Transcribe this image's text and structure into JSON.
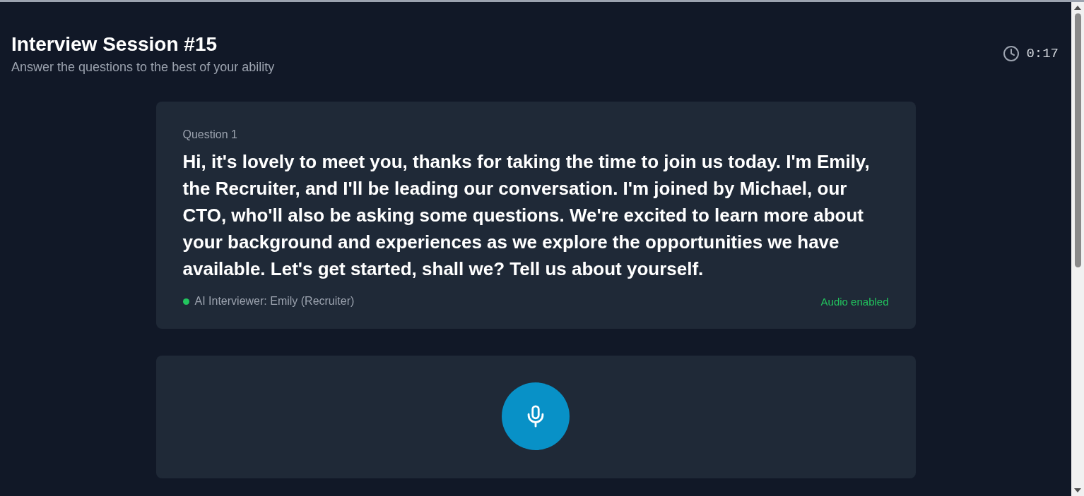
{
  "header": {
    "title": "Interview Session #15",
    "subtitle": "Answer the questions to the best of your ability",
    "timer": "0:17"
  },
  "question": {
    "label": "Question 1",
    "text": "Hi, it's lovely to meet you, thanks for taking the time to join us today. I'm Emily, the Recruiter, and I'll be leading our conversation. I'm joined by Michael, our CTO, who'll also be asking some questions. We're excited to learn more about your background and experiences as we explore the opportunities we have available. Let's get started, shall we? Tell us about yourself.",
    "interviewer": {
      "label": "AI Interviewer: Emily (Recruiter)",
      "color": "#22c55e"
    },
    "audio": {
      "label": "Audio enabled",
      "enabled": true
    }
  },
  "recorder": {
    "recording": false
  }
}
